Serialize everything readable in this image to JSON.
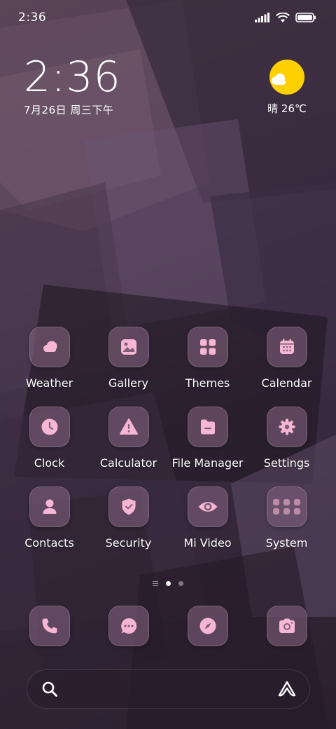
{
  "status_bar": {
    "time": "2:36",
    "signal_icon": "signal-bars-icon",
    "wifi_icon": "wifi-icon",
    "battery_icon": "battery-icon"
  },
  "clock_widget": {
    "time": "2:36",
    "date": "7月26日 周三下午"
  },
  "weather_widget": {
    "icon": "partly-sunny-icon",
    "text": "晴 26℃"
  },
  "apps": [
    {
      "label": "Weather",
      "icon": "weather-cloud-icon"
    },
    {
      "label": "Gallery",
      "icon": "gallery-image-icon"
    },
    {
      "label": "Themes",
      "icon": "themes-grid-icon"
    },
    {
      "label": "Calendar",
      "icon": "calendar-icon"
    },
    {
      "label": "Clock",
      "icon": "clock-icon"
    },
    {
      "label": "Calculator",
      "icon": "warning-triangle-icon"
    },
    {
      "label": "File Manager",
      "icon": "folder-icon"
    },
    {
      "label": "Settings",
      "icon": "gear-icon"
    },
    {
      "label": "Contacts",
      "icon": "person-icon"
    },
    {
      "label": "Security",
      "icon": "shield-check-icon"
    },
    {
      "label": "Mi Video",
      "icon": "eye-icon"
    },
    {
      "label": "System",
      "icon": "folder-app-grid-icon"
    }
  ],
  "pager": {
    "pages": 2,
    "active_index": 0
  },
  "dock": [
    {
      "name": "phone",
      "icon": "phone-icon"
    },
    {
      "name": "messages",
      "icon": "chat-bubble-icon"
    },
    {
      "name": "browser",
      "icon": "compass-icon"
    },
    {
      "name": "camera",
      "icon": "camera-icon"
    }
  ],
  "search_bar": {
    "search_icon": "search-icon",
    "assistant_icon": "assistant-a-icon"
  },
  "colors": {
    "icon_glyph": "#f7b6d4",
    "icon_tile": "#7e607a",
    "sun": "#ffd000",
    "wallpaper_dark": "#2a1f2e",
    "wallpaper_light": "#5a4458"
  }
}
